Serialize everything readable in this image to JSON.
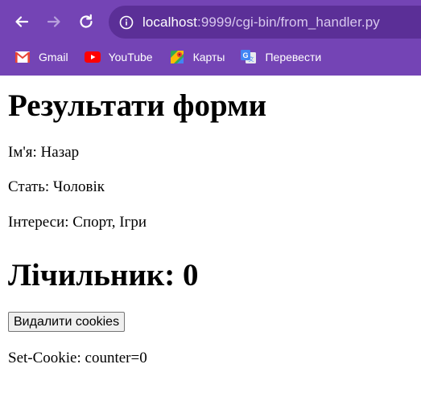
{
  "browser": {
    "url_host": "localhost",
    "url_rest": ":9999/cgi-bin/from_handler.py",
    "bookmarks": [
      {
        "label": "Gmail",
        "icon": "gmail-icon"
      },
      {
        "label": "YouTube",
        "icon": "youtube-icon"
      },
      {
        "label": "Карты",
        "icon": "maps-icon"
      },
      {
        "label": "Перевести",
        "icon": "translate-icon"
      }
    ],
    "colors": {
      "toolbar": "#7444b5",
      "omnibox": "#5b2f97"
    }
  },
  "page": {
    "title": "Результати форми",
    "name_line": "Ім'я: Назар",
    "gender_line": "Стать: Чоловік",
    "interests_line": "Інтереси: Спорт, Ігри",
    "counter_heading": "Лічильник: 0",
    "delete_button": "Видалити cookies",
    "cookie_line": "Set-Cookie: counter=0"
  }
}
